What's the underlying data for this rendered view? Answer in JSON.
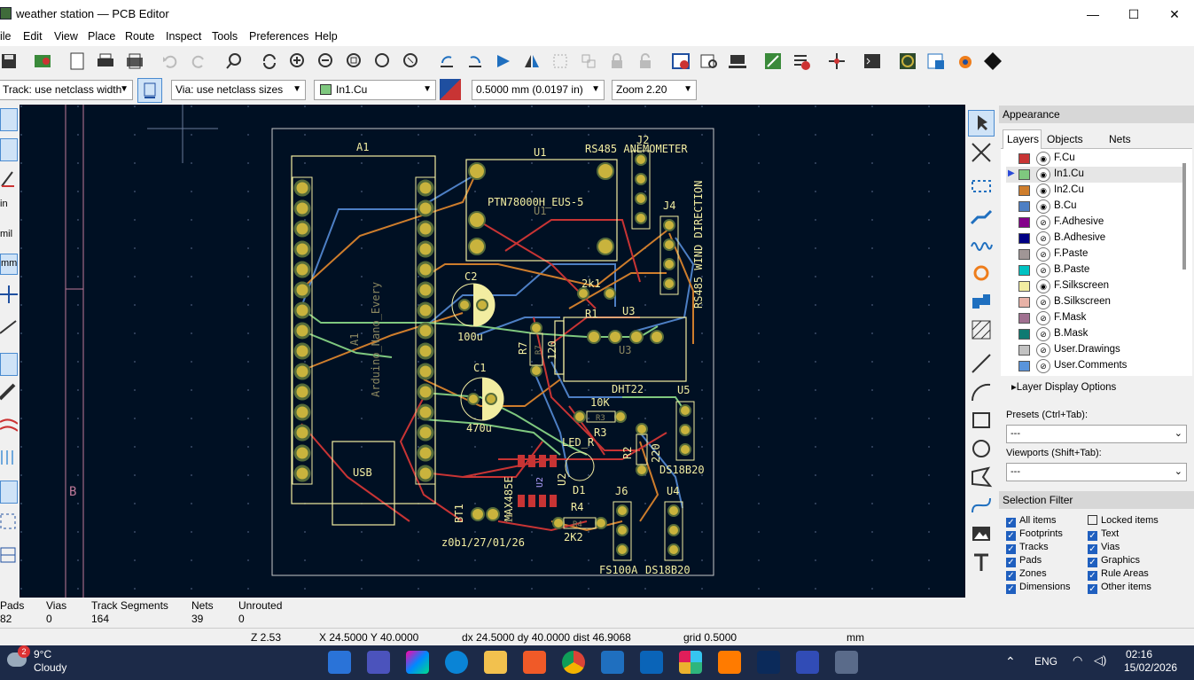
{
  "window": {
    "title": "weather station — PCB Editor",
    "min": "—",
    "max": "☐",
    "close": "✕"
  },
  "menu": [
    "ile",
    "Edit",
    "View",
    "Place",
    "Route",
    "Inspect",
    "Tools",
    "Preferences",
    "Help"
  ],
  "options": {
    "track": "Track: use netclass width",
    "via": "Via: use netclass sizes",
    "layer": "In1.Cu",
    "grid": "0.5000 mm (0.0197 in)",
    "zoom": "Zoom 2.20"
  },
  "left_toolbar": {
    "in": "in",
    "mil": "mil",
    "mm": "mm"
  },
  "pcb": {
    "labels": {
      "a1": "A1",
      "u1": "U1",
      "rs485_anem": "RS485 ANEMOMETER",
      "j2": "J2",
      "ptn": "PTN78000H_EUS-5",
      "u1b": "U1",
      "j4": "J4",
      "wind": "RS485 WIND DIRECTION",
      "c2": "C2",
      "r1b": "2k1",
      "r1": "R1",
      "u3": "U3",
      "u3b": "U3",
      "c2v": "100u",
      "r7": "R7",
      "r7v": "120",
      "r7b": "R7",
      "c1": "C1",
      "arduino": "Arduino_Nano_Every",
      "a1b": "A1",
      "dht22": "DHT22",
      "u5": "U5",
      "r3v": "10K",
      "r3": "R3",
      "r3b": "R3",
      "c1v": "470u",
      "led": "LED_R",
      "r2": "R2",
      "r2v": "220",
      "ds1": "DS18B20",
      "usb": "USB",
      "max": "MAX485E",
      "u2": "U2",
      "d1": "D1",
      "u2b": "U2",
      "j6": "J6",
      "u4": "U4",
      "r4": "R4",
      "r4b": "R4",
      "bt1": "BT1",
      "bt1b": "12",
      "date": "z0b1/27/01/26",
      "r4v": "2K2",
      "fs": "FS100A",
      "ds2": "DS18B20",
      "b": "B"
    }
  },
  "appearance": {
    "title": "Appearance",
    "tabs": [
      "Layers",
      "Objects",
      "Nets"
    ],
    "layers": [
      {
        "name": "F.Cu",
        "color": "#c83434",
        "visible": true
      },
      {
        "name": "In1.Cu",
        "color": "#7fc87f",
        "visible": true
      },
      {
        "name": "In2.Cu",
        "color": "#ce7d2c",
        "visible": true
      },
      {
        "name": "B.Cu",
        "color": "#4d7fc4",
        "visible": true
      },
      {
        "name": "F.Adhesive",
        "color": "#84008a",
        "visible": false
      },
      {
        "name": "B.Adhesive",
        "color": "#000084",
        "visible": false
      },
      {
        "name": "F.Paste",
        "color": "#a09696",
        "visible": false
      },
      {
        "name": "B.Paste",
        "color": "#00c2c2",
        "visible": false
      },
      {
        "name": "F.Silkscreen",
        "color": "#f2eda1",
        "visible": true
      },
      {
        "name": "B.Silkscreen",
        "color": "#e8b2a7",
        "visible": false
      },
      {
        "name": "F.Mask",
        "color": "#a07090",
        "visible": false
      },
      {
        "name": "B.Mask",
        "color": "#0e7a72",
        "visible": false
      },
      {
        "name": "User.Drawings",
        "color": "#c2c2c2",
        "visible": false
      },
      {
        "name": "User.Comments",
        "color": "#5994dc",
        "visible": false
      }
    ],
    "layer_display": "Layer Display Options",
    "presets_label": "Presets (Ctrl+Tab):",
    "presets_value": "---",
    "viewports_label": "Viewports (Shift+Tab):",
    "viewports_value": "---"
  },
  "selection_filter": {
    "title": "Selection Filter",
    "items": [
      {
        "label": "All items",
        "checked": true
      },
      {
        "label": "Locked items",
        "checked": false
      },
      {
        "label": "Footprints",
        "checked": true
      },
      {
        "label": "Text",
        "checked": true
      },
      {
        "label": "Tracks",
        "checked": true
      },
      {
        "label": "Vias",
        "checked": true
      },
      {
        "label": "Pads",
        "checked": true
      },
      {
        "label": "Graphics",
        "checked": true
      },
      {
        "label": "Zones",
        "checked": true
      },
      {
        "label": "Rule Areas",
        "checked": true
      },
      {
        "label": "Dimensions",
        "checked": true
      },
      {
        "label": "Other items",
        "checked": true
      }
    ]
  },
  "messages": {
    "pads_h": "Pads",
    "pads_v": "82",
    "vias_h": "Vias",
    "vias_v": "0",
    "tracks_h": "Track Segments",
    "tracks_v": "164",
    "nets_h": "Nets",
    "nets_v": "39",
    "unrouted_h": "Unrouted",
    "unrouted_v": "0"
  },
  "status": {
    "z": "Z 2.53",
    "xy": "X 24.5000  Y 40.0000",
    "d": "dx 24.5000  dy 40.0000  dist 46.9068",
    "grid": "grid 0.5000",
    "units": "mm"
  },
  "taskbar": {
    "temp": "9°C",
    "weather": "Cloudy",
    "badge": "2",
    "lang": "ENG",
    "time": "02:16",
    "date": "15/02/2026"
  },
  "colors": {
    "board_bg": "#001023",
    "silk": "#f2eda1",
    "fcu": "#c83434",
    "in1": "#7fc87f",
    "in2": "#ce7d2c",
    "bcu": "#4d7fc4",
    "pad": "#c9b33d"
  }
}
